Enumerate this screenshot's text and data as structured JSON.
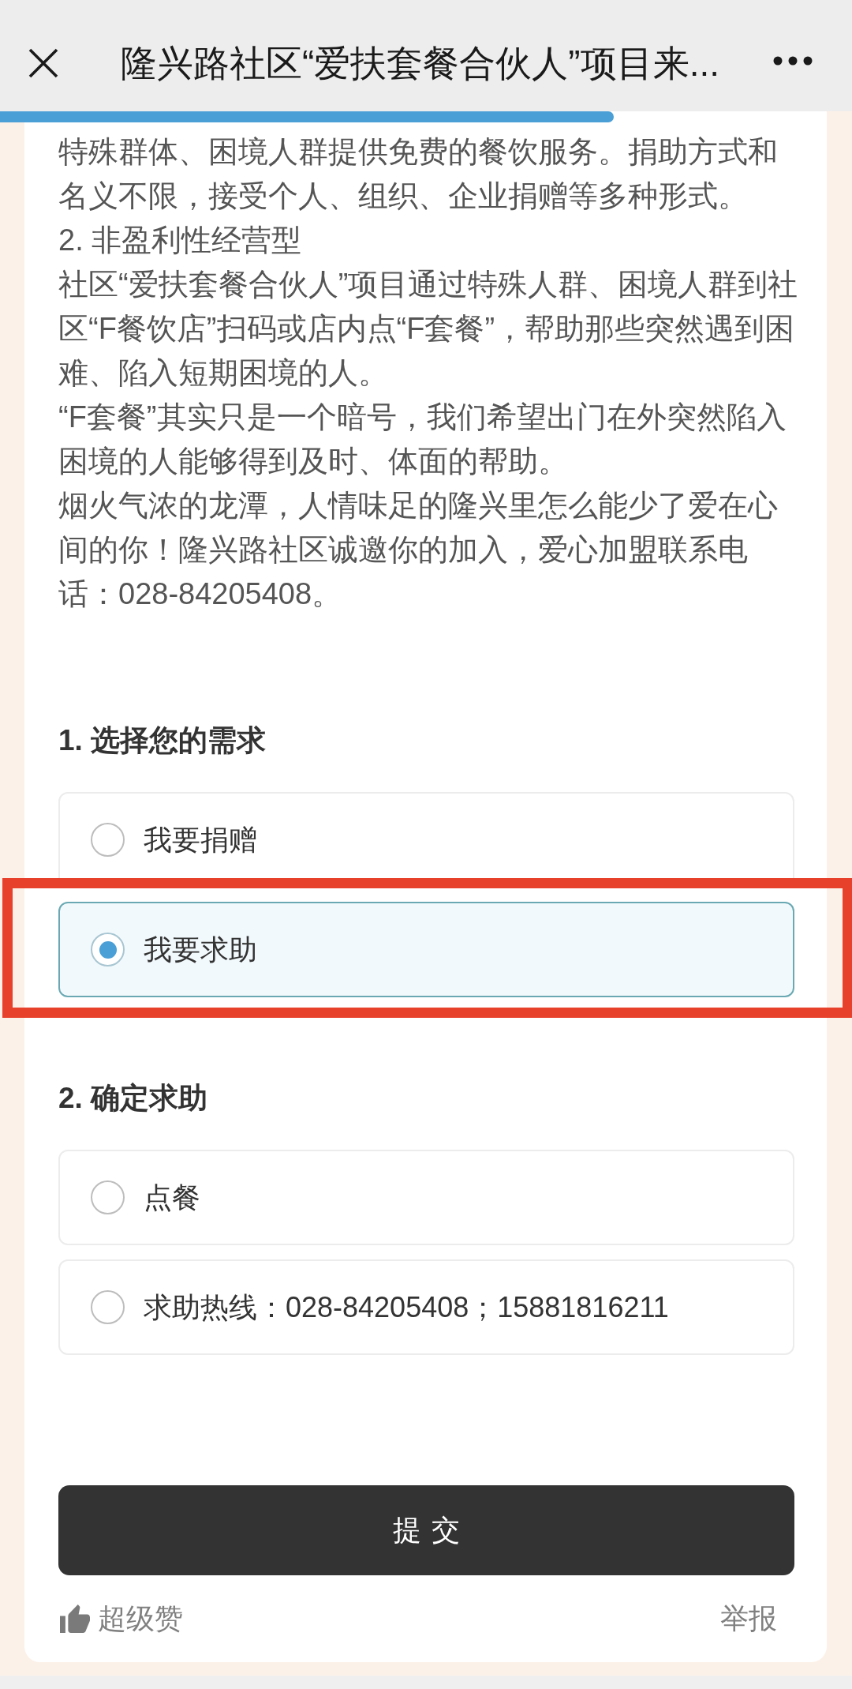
{
  "window": {
    "title": "隆兴路社区“爱扶套餐合伙人”项目来..."
  },
  "page_load": {
    "level": 0.72
  },
  "article": {
    "paragraphs": [
      "特殊群体、困境人群提供免费的餐饮服务。捐助方式和名义不限，接受个人、组织、企业捐赠等多种形式。",
      "2. 非盈利性经营型",
      "社区“爱扶套餐合伙人”项目通过特殊人群、困境人群到社区“F餐饮店”扫码或店内点“F套餐”，帮助那些突然遇到困难、陷入短期困境的人。",
      "“F套餐”其实只是一个暗号，我们希望出门在外突然陷入困境的人能够得到及时、体面的帮助。",
      "烟火气浓的龙潭，人情味足的隆兴里怎么能少了爱在心间的你！隆兴路社区诚邀你的加入，爱心加盟联系电话：028-84205408。"
    ]
  },
  "questions": [
    {
      "title": "1. 选择您的需求",
      "options": [
        {
          "label": "我要捐赠",
          "selected": false,
          "highlighted": false
        },
        {
          "label": "我要求助",
          "selected": true,
          "highlighted": true
        }
      ]
    },
    {
      "title": "2. 确定求助",
      "options": [
        {
          "label": "点餐",
          "selected": false,
          "highlighted": false
        },
        {
          "label": "求助热线：028-84205408；15881816211",
          "selected": false,
          "highlighted": false
        }
      ]
    }
  ],
  "submit_button": {
    "label": "提交"
  },
  "footer": {
    "like": {
      "label": "超级赞"
    },
    "report": {
      "label": "举报"
    }
  }
}
